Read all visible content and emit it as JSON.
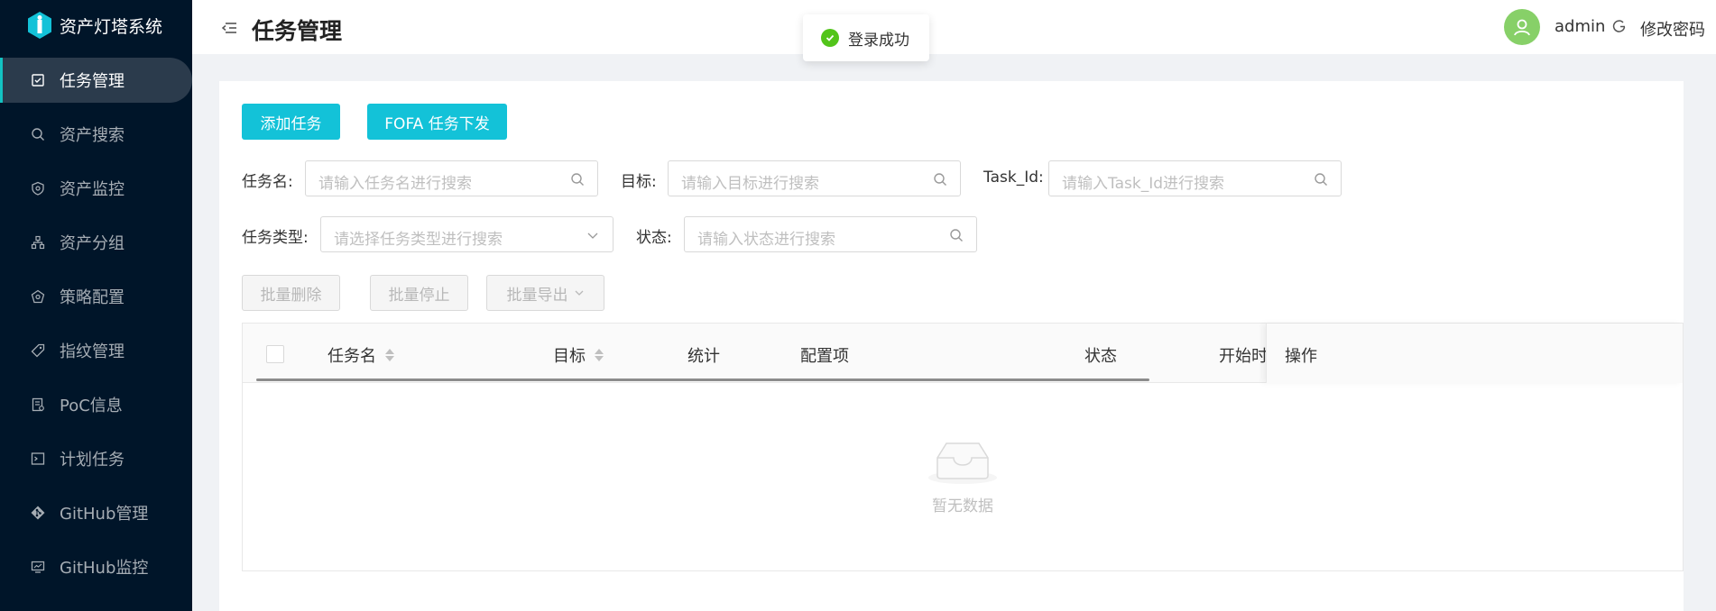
{
  "app": {
    "title": "资产灯塔系统"
  },
  "sidebar": {
    "items": [
      {
        "label": "任务管理",
        "icon": "task-icon",
        "active": true
      },
      {
        "label": "资产搜索",
        "icon": "search-icon"
      },
      {
        "label": "资产监控",
        "icon": "shield-icon"
      },
      {
        "label": "资产分组",
        "icon": "group-icon"
      },
      {
        "label": "策略配置",
        "icon": "policy-icon"
      },
      {
        "label": "指纹管理",
        "icon": "tag-icon"
      },
      {
        "label": "PoC信息",
        "icon": "doc-icon"
      },
      {
        "label": "计划任务",
        "icon": "terminal-icon"
      },
      {
        "label": "GitHub管理",
        "icon": "git-icon"
      },
      {
        "label": "GitHub监控",
        "icon": "monitor-icon"
      }
    ]
  },
  "header": {
    "title": "任务管理",
    "username": "admin",
    "change_password": "修改密码"
  },
  "toast": {
    "message": "登录成功"
  },
  "toolbar": {
    "add_task": "添加任务",
    "fofa_task": "FOFA 任务下发"
  },
  "filters": {
    "task_name": {
      "label": "任务名:",
      "placeholder": "请输入任务名进行搜索"
    },
    "target": {
      "label": "目标:",
      "placeholder": "请输入目标进行搜索"
    },
    "task_id": {
      "label": "Task_Id:",
      "placeholder": "请输入Task_Id进行搜索"
    },
    "task_type": {
      "label": "任务类型:",
      "placeholder": "请选择任务类型进行搜索"
    },
    "status": {
      "label": "状态:",
      "placeholder": "请输入状态进行搜索"
    }
  },
  "batch": {
    "delete": "批量删除",
    "stop": "批量停止",
    "export": "批量导出"
  },
  "table": {
    "columns": [
      "任务名",
      "目标",
      "统计",
      "配置项",
      "状态",
      "开始时",
      "操作"
    ],
    "empty_text": "暂无数据"
  },
  "colors": {
    "sidebar_bg": "#001529",
    "primary": "#13c2d8",
    "success": "#52c41a",
    "avatar": "#87d068"
  }
}
